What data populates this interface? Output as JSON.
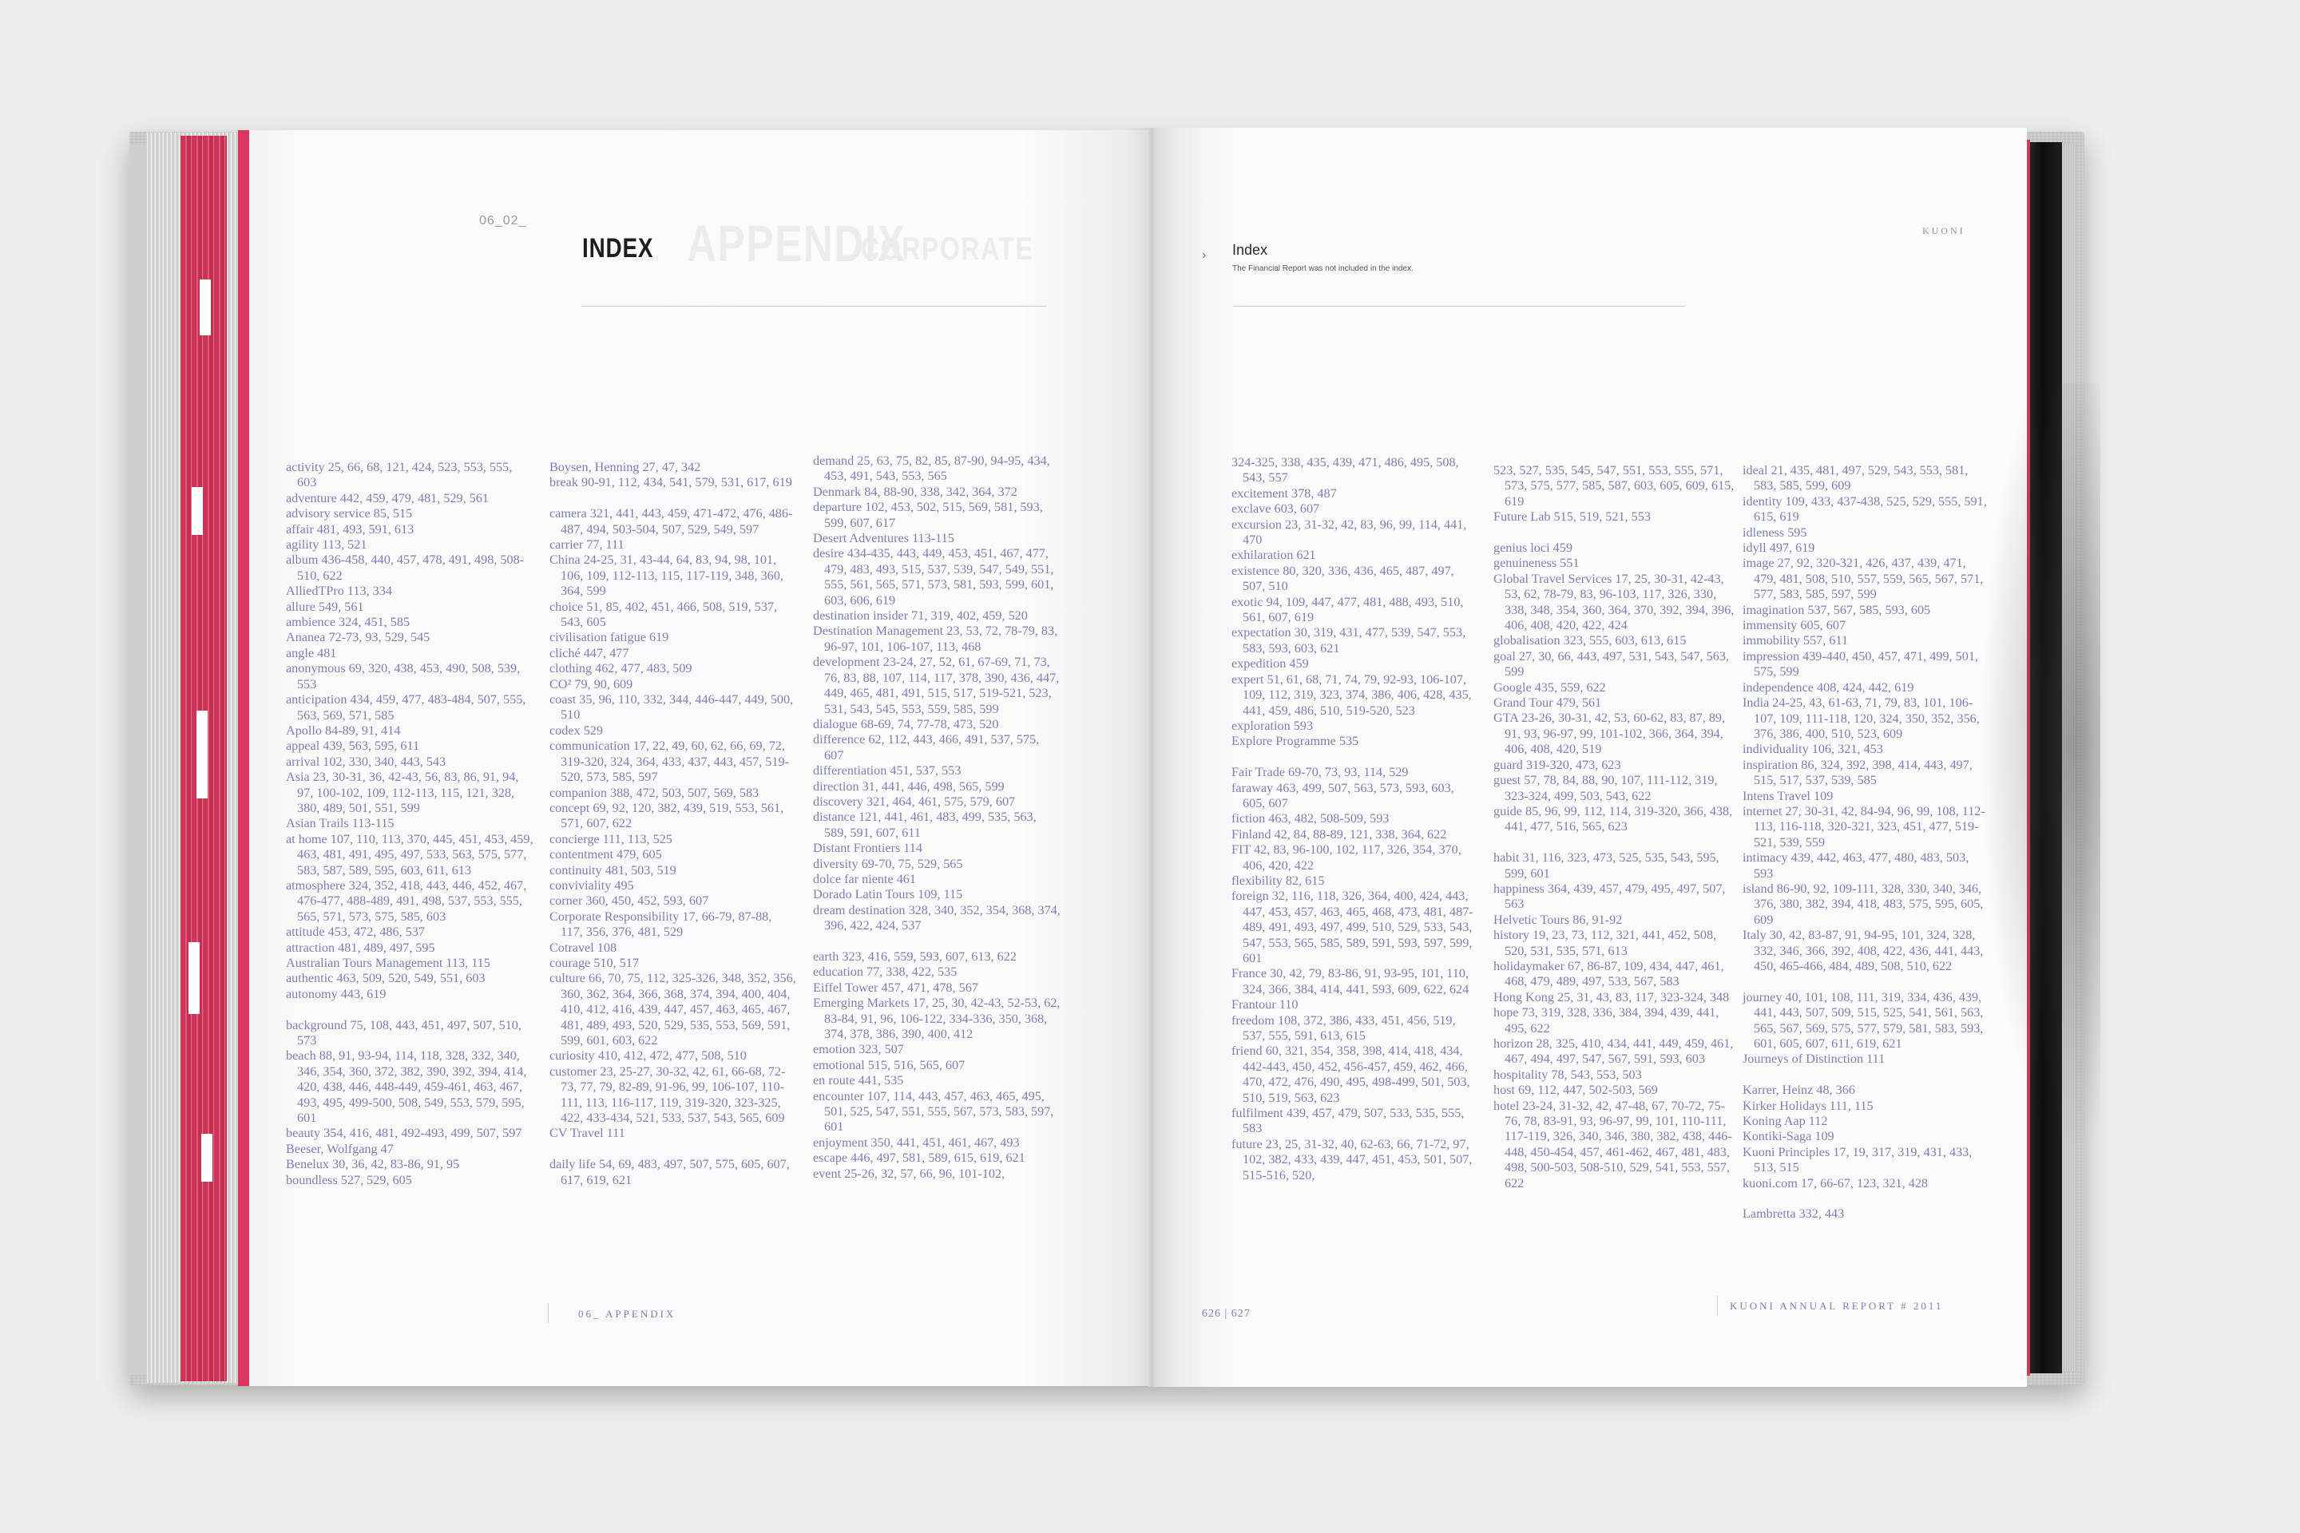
{
  "left_page": {
    "section_number": "06_02_",
    "title": "INDEX",
    "ghost_title": "APPENDIX",
    "ghost_subtitle": "CORPORATE",
    "footer": "06_ APPENDIX"
  },
  "right_page": {
    "title": "Index",
    "note": "The Financial Report was not included in the index.",
    "brand": "KUONI",
    "page_numbers": "626 | 627",
    "footer": "KUONI ANNUAL REPORT # 2011"
  },
  "columns": [
    [
      "activity 25, 66, 68, 121, 424, 523, 553, 555, 603",
      "adventure 442, 459, 479, 481, 529, 561",
      "advisory service 85, 515",
      "affair 481, 493, 591, 613",
      "agility 113, 521",
      "album 436-458, 440, 457, 478, 491, 498, 508-510, 622",
      "AlliedTPro 113, 334",
      "allure 549, 561",
      "ambience 324, 451, 585",
      "Ananea 72-73, 93, 529, 545",
      "angle 481",
      "anonymous 69, 320, 438, 453, 490, 508, 539, 553",
      "anticipation 434, 459, 477, 483-484, 507, 555, 563, 569, 571, 585",
      "Apollo 84-89, 91, 414",
      "appeal 439, 563, 595, 611",
      "arrival 102, 330, 340, 443, 543",
      "Asia 23, 30-31, 36, 42-43, 56, 83, 86, 91, 94, 97, 100-102, 109, 112-113, 115, 121, 328, 380, 489, 501, 551, 599",
      "Asian Trails 113-115",
      "at home 107, 110, 113, 370, 445, 451, 453, 459, 463, 481, 491, 495, 497, 533, 563, 575, 577, 583, 587, 589, 595, 603, 611, 613",
      "atmosphere 324, 352, 418, 443, 446, 452, 467, 476-477, 488-489, 491, 498, 537, 553, 555, 565, 571, 573, 575, 585, 603",
      "attitude 453, 472, 486, 537",
      "attraction 481, 489, 497, 595",
      "Australian Tours Management 113, 115",
      "authentic 463, 509, 520, 549, 551, 603",
      "autonomy 443, 619",
      "",
      "background 75, 108, 443, 451, 497, 507, 510, 573",
      "beach 88, 91, 93-94, 114, 118, 328, 332, 340, 346, 354, 360, 372, 382, 390, 392, 394, 414, 420, 438, 446, 448-449, 459-461, 463, 467, 493, 495, 499-500, 508, 549, 553, 579, 595, 601",
      "beauty 354, 416, 481, 492-493, 499, 507, 597",
      "Beeser, Wolfgang 47",
      "Benelux 30, 36, 42, 83-86, 91, 95",
      "boundless 527, 529, 605"
    ],
    [
      "Boysen, Henning 27, 47, 342",
      "break 90-91, 112, 434, 541, 579, 531, 617, 619",
      "",
      "camera 321, 441, 443, 459, 471-472, 476, 486-487, 494, 503-504, 507, 529, 549, 597",
      "carrier 77, 111",
      "China 24-25, 31, 43-44, 64, 83, 94, 98, 101, 106, 109, 112-113, 115, 117-119, 348, 360, 364, 599",
      "choice 51, 85, 402, 451, 466, 508, 519, 537, 543, 605",
      "civilisation fatigue 619",
      "cliché 447, 477",
      "clothing 462, 477, 483, 509",
      "CO² 79, 90, 609",
      "coast 35, 96, 110, 332, 344, 446-447, 449, 500, 510",
      "codex 529",
      "communication 17, 22, 49, 60, 62, 66, 69, 72, 319-320, 324, 364, 433, 437, 443, 457, 519-520, 573, 585, 597",
      "companion 388, 472, 503, 507, 569, 583",
      "concept 69, 92, 120, 382, 439, 519, 553, 561, 571, 607, 622",
      "concierge 111, 113, 525",
      "contentment 479, 605",
      "continuity 481, 503, 519",
      "conviviality 495",
      "corner 360, 450, 452, 593, 607",
      "Corporate Responsibility 17, 66-79, 87-88, 117, 356, 376, 481, 529",
      "Cotravel 108",
      "courage 510, 517",
      "culture 66, 70, 75, 112, 325-326, 348, 352, 356, 360, 362, 364, 366, 368, 374, 394, 400, 404, 410, 412, 416, 439, 447, 457, 463, 465, 467, 481, 489, 493, 520, 529, 535, 553, 569, 591, 599, 601, 603, 622",
      "curiosity 410, 412, 472, 477, 508, 510",
      "customer 23, 25-27, 30-32, 42, 61, 66-68, 72-73, 77, 79, 82-89, 91-96, 99, 106-107, 110-111, 113, 116-117, 119, 319-320, 323-325, 422, 433-434, 521, 533, 537, 543, 565, 609",
      "CV Travel 111",
      "",
      "daily life 54, 69, 483, 497, 507, 575, 605, 607, 617, 619, 621"
    ],
    [
      "demand 25, 63, 75, 82, 85, 87-90, 94-95, 434, 453, 491, 543, 553, 565",
      "Denmark 84, 88-90, 338, 342, 364, 372",
      "departure 102, 453, 502, 515, 569, 581, 593, 599, 607, 617",
      "Desert Adventures 113-115",
      "desire 434-435, 443, 449, 453, 451, 467, 477, 479, 483, 493, 515, 537, 539, 547, 549, 551, 555, 561, 565, 571, 573, 581, 593, 599, 601, 603, 606, 619",
      "destination insider 71, 319, 402, 459, 520",
      "Destination Management 23, 53, 72, 78-79, 83, 96-97, 101, 106-107, 113, 468",
      "development 23-24, 27, 52, 61, 67-69, 71, 73, 76, 83, 88, 107, 114, 117, 378, 390, 436, 447, 449, 465, 481, 491, 515, 517, 519-521, 523, 531, 543, 545, 553, 559, 585, 599",
      "dialogue 68-69, 74, 77-78, 473, 520",
      "difference 62, 112, 443, 466, 491, 537, 575, 607",
      "differentiation 451, 537, 553",
      "direction 31, 441, 446, 498, 565, 599",
      "discovery 321, 464, 461, 575, 579, 607",
      "distance 121, 441, 461, 483, 499, 535, 563, 589, 591, 607, 611",
      "Distant Frontiers 114",
      "diversity 69-70, 75, 529, 565",
      "dolce far niente 461",
      "Dorado Latin Tours 109, 115",
      "dream destination 328, 340, 352, 354, 368, 374, 396, 422, 424, 537",
      "",
      "earth 323, 416, 559, 593, 607, 613, 622",
      "education 77, 338, 422, 535",
      "Eiffel Tower 457, 471, 478, 567",
      "Emerging Markets 17, 25, 30, 42-43, 52-53, 62, 83-84, 91, 96, 106-122, 334-336, 350, 368, 374, 378, 386, 390, 400, 412",
      "emotion 323, 507",
      "emotional 515, 516, 565, 607",
      "en route 441, 535",
      "encounter 107, 114, 443, 457, 463, 465, 495, 501, 525, 547, 551, 555, 567, 573, 583, 597, 601",
      "enjoyment 350, 441, 451, 461, 467, 493",
      "escape 446, 497, 581, 589, 615, 619, 621",
      "event 25-26, 32, 57, 66, 96, 101-102,"
    ],
    [
      "324-325, 338, 435, 439, 471, 486, 495, 508, 543, 557",
      "excitement 378, 487",
      "exclave 603, 607",
      "excursion 23, 31-32, 42, 83, 96, 99, 114, 441, 470",
      "exhilaration 621",
      "existence 80, 320, 336, 436, 465, 487, 497, 507, 510",
      "exotic 94, 109, 447, 477, 481, 488, 493, 510, 561, 607, 619",
      "expectation 30, 319, 431, 477, 539, 547, 553, 583, 593, 603, 621",
      "expedition 459",
      "expert 51, 61, 68, 71, 74, 79, 92-93, 106-107, 109, 112, 319, 323, 374, 386, 406, 428, 435, 441, 459, 486, 510, 519-520, 523",
      "exploration 593",
      "Explore Programme 535",
      "",
      "Fair Trade 69-70, 73, 93, 114, 529",
      "faraway 463, 499, 507, 563, 573, 593, 603, 605, 607",
      "fiction 463, 482, 508-509, 593",
      "Finland 42, 84, 88-89, 121, 338, 364, 622",
      "FIT 42, 83, 96-100, 102, 117, 326, 354, 370, 406, 420, 422",
      "flexibility 82, 615",
      "foreign 32, 116, 118, 326, 364, 400, 424, 443, 447, 453, 457, 463, 465, 468, 473, 481, 487-489, 491, 493, 497, 499, 510, 529, 533, 543, 547, 553, 565, 585, 589, 591, 593, 597, 599, 601",
      "France 30, 42, 79, 83-86, 91, 93-95, 101, 110, 324, 366, 384, 414, 441, 593, 609, 622, 624",
      "Frantour 110",
      "freedom 108, 372, 386, 433, 451, 456, 519, 537, 555, 591, 613, 615",
      "friend 60, 321, 354, 358, 398, 414, 418, 434, 442-443, 450, 452, 456-457, 459, 462, 466, 470, 472, 476, 490, 495, 498-499, 501, 503, 510, 519, 563, 623",
      "fulfilment 439, 457, 479, 507, 533, 535, 555, 583",
      "future 23, 25, 31-32, 40, 62-63, 66, 71-72, 97, 102, 382, 433, 439, 447, 451, 453, 501, 507, 515-516, 520,"
    ],
    [
      "523, 527, 535, 545, 547, 551, 553, 555, 571, 573, 575, 577, 585, 587, 603, 605, 609, 615, 619",
      "Future Lab 515, 519, 521, 553",
      "",
      "genius loci 459",
      "genuineness 551",
      "Global Travel Services 17, 25, 30-31, 42-43, 53, 62, 78-79, 83, 96-103, 117, 326, 330, 338, 348, 354, 360, 364, 370, 392, 394, 396, 406, 408, 420, 422, 424",
      "globalisation 323, 555, 603, 613, 615",
      "goal 27, 30, 66, 443, 497, 531, 543, 547, 563, 599",
      "Google 435, 559, 622",
      "Grand Tour 479, 561",
      "GTA 23-26, 30-31, 42, 53, 60-62, 83, 87, 89, 91, 93, 96-97, 99, 101-102, 366, 364, 394, 406, 408, 420, 519",
      "guard 319-320, 473, 623",
      "guest 57, 78, 84, 88, 90, 107, 111-112, 319, 323-324, 499, 503, 543, 622",
      "guide 85, 96, 99, 112, 114, 319-320, 366, 438, 441, 477, 516, 565, 623",
      "",
      "habit 31, 116, 323, 473, 525, 535, 543, 595, 599, 601",
      "happiness 364, 439, 457, 479, 495, 497, 507, 563",
      "Helvetic Tours 86, 91-92",
      "history 19, 23, 73, 112, 321, 441, 452, 508, 520, 531, 535, 571, 613",
      "holidaymaker 67, 86-87, 109, 434, 447, 461, 468, 479, 489, 497, 533, 567, 583",
      "Hong Kong 25, 31, 43, 83, 117, 323-324, 348",
      "hope 73, 319, 328, 336, 384, 394, 439, 441, 495, 622",
      "horizon 28, 325, 410, 434, 441, 449, 459, 461, 467, 494, 497, 547, 567, 591, 593, 603",
      "hospitality 78, 543, 553, 503",
      "host 69, 112, 447, 502-503, 569",
      "hotel 23-24, 31-32, 42, 47-48, 67, 70-72, 75-76, 78, 83-91, 93, 96-97, 99, 101, 110-111, 117-119, 326, 340, 346, 380, 382, 438, 446-448, 450-454, 457, 461-462, 467, 481, 483, 498, 500-503, 508-510, 529, 541, 553, 557, 622"
    ],
    [
      "ideal 21, 435, 481, 497, 529, 543, 553, 581, 583, 585, 599, 609",
      "identity 109, 433, 437-438, 525, 529, 555, 591, 615, 619",
      "idleness 595",
      "idyll 497, 619",
      "image 27, 92, 320-321, 426, 437, 439, 471, 479, 481, 508, 510, 557, 559, 565, 567, 571, 577, 583, 585, 597, 599",
      "imagination 537, 567, 585, 593, 605",
      "immensity 605, 607",
      "immobility 557, 611",
      "impression 439-440, 450, 457, 471, 499, 501, 575, 599",
      "independence 408, 424, 442, 619",
      "India 24-25, 43, 61-63, 71, 79, 83, 101, 106-107, 109, 111-118, 120, 324, 350, 352, 356, 376, 386, 400, 510, 523, 609",
      "individuality 106, 321, 453",
      "inspiration 86, 324, 392, 398, 414, 443, 497, 515, 517, 537, 539, 585",
      "Intens Travel 109",
      "internet 27, 30-31, 42, 84-94, 96, 99, 108, 112-113, 116-118, 320-321, 323, 451, 477, 519-521, 539, 559",
      "intimacy 439, 442, 463, 477, 480, 483, 503, 593",
      "island 86-90, 92, 109-111, 328, 330, 340, 346, 376, 380, 382, 394, 418, 483, 575, 595, 605, 609",
      "Italy 30, 42, 83-87, 91, 94-95, 101, 324, 328, 332, 346, 366, 392, 408, 422, 436, 441, 443, 450, 465-466, 484, 489, 508, 510, 622",
      "",
      "journey 40, 101, 108, 111, 319, 334, 436, 439, 441, 443, 507, 509, 515, 525, 541, 561, 563, 565, 567, 569, 575, 577, 579, 581, 583, 593, 601, 605, 607, 611, 619, 621",
      "Journeys of Distinction 111",
      "",
      "Karrer, Heinz 48, 366",
      "Kirker Holidays 111, 115",
      "Koning Aap 112",
      "Kontiki-Saga 109",
      "Kuoni Principles 17, 19, 317, 319, 431, 433, 513, 515",
      "kuoni.com 17, 66-67, 123, 321, 428",
      "",
      "Lambretta 332, 443"
    ]
  ]
}
